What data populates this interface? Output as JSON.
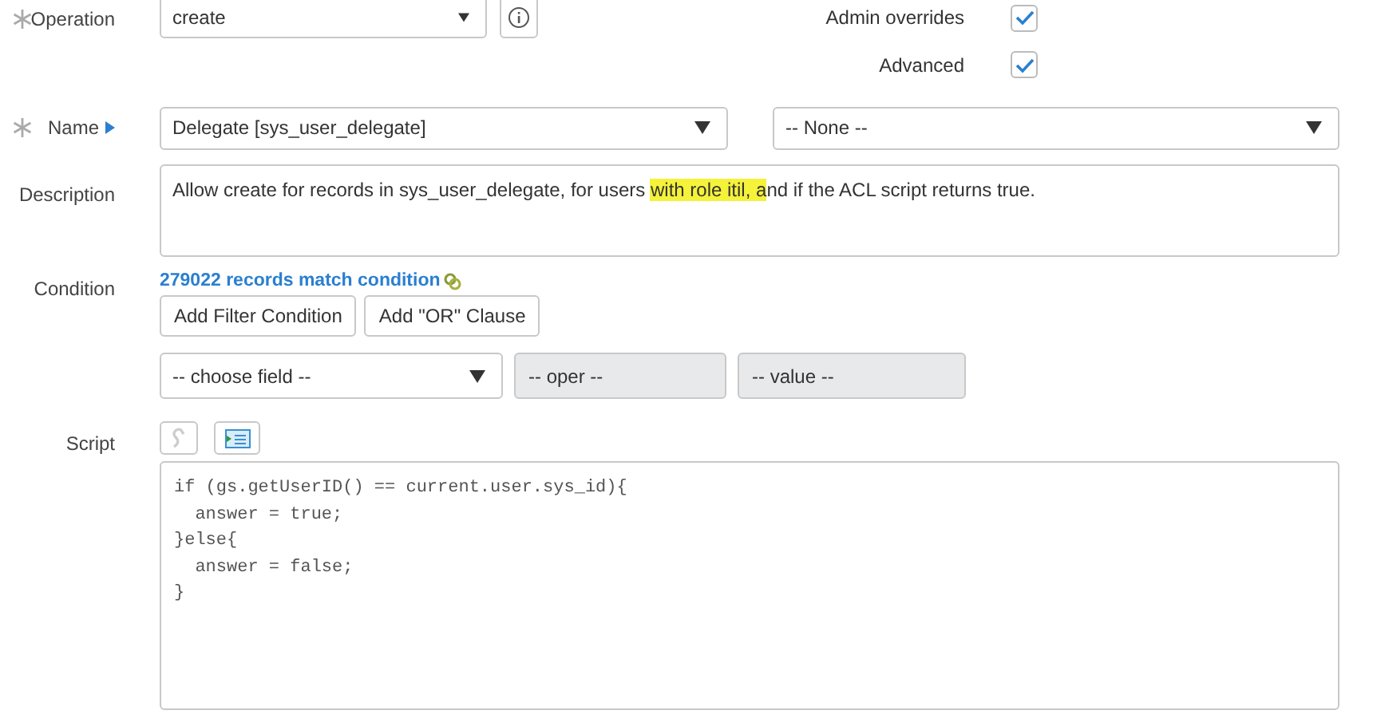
{
  "operation": {
    "label": "Operation",
    "required": true,
    "value": "create"
  },
  "flags": [
    {
      "label": "Admin overrides",
      "checked": true
    },
    {
      "label": "Advanced",
      "checked": true
    }
  ],
  "name": {
    "label": "Name",
    "required": true,
    "value": "Delegate [sys_user_delegate]",
    "field": "-- None --"
  },
  "description": {
    "label": "Description",
    "segments": [
      {
        "text": "Allow create for records in sys_user_delegate, for users ",
        "highlighted": false
      },
      {
        "text": "with role itil, a",
        "highlighted": true
      },
      {
        "text": "nd if the ACL script returns true.",
        "highlighted": false
      }
    ]
  },
  "condition": {
    "label": "Condition",
    "match_link": "279022 records match condition",
    "buttons": [
      "Add Filter Condition",
      "Add \"OR\" Clause"
    ],
    "field_placeholder": "-- choose field --",
    "oper_placeholder": "-- oper --",
    "value_placeholder": "-- value --"
  },
  "script": {
    "label": "Script",
    "lines": [
      "if (gs.getUserID() == current.user.sys_id){",
      "  answer = true;",
      "}else{",
      "  answer = false;",
      "}"
    ]
  }
}
